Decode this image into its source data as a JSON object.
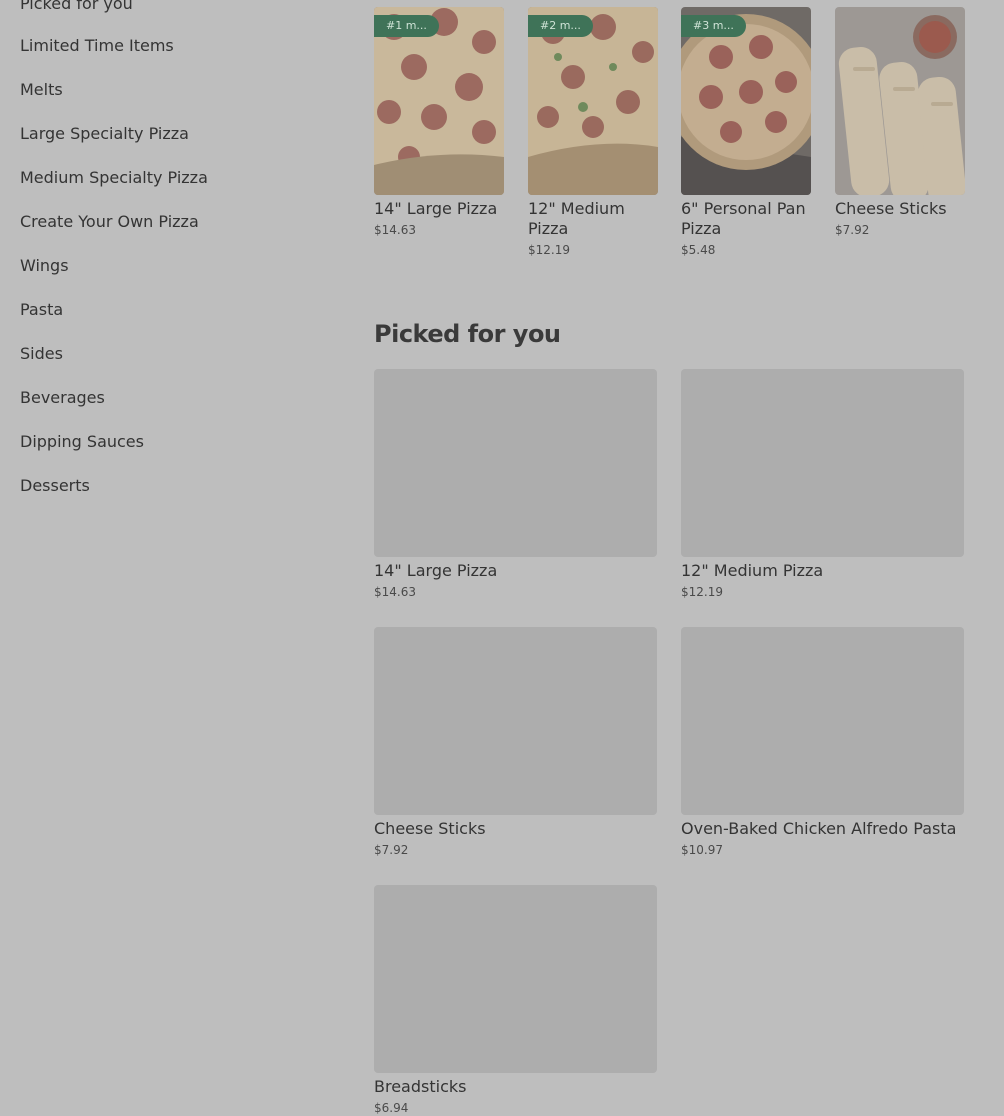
{
  "sidebar": {
    "items": [
      {
        "label": "Picked for you"
      },
      {
        "label": "Limited Time Items"
      },
      {
        "label": "Melts"
      },
      {
        "label": "Large Specialty Pizza"
      },
      {
        "label": "Medium Specialty Pizza"
      },
      {
        "label": "Create Your Own Pizza"
      },
      {
        "label": "Wings"
      },
      {
        "label": "Pasta"
      },
      {
        "label": "Sides"
      },
      {
        "label": "Beverages"
      },
      {
        "label": "Dipping Sauces"
      },
      {
        "label": "Desserts"
      }
    ]
  },
  "popular": [
    {
      "badge": "#1 m...",
      "name": "14\" Large Pizza",
      "price": "$14.63",
      "icon": "pizza-image"
    },
    {
      "badge": "#2 m...",
      "name": "12\" Medium Pizza",
      "price": "$12.19",
      "icon": "pizza-image"
    },
    {
      "badge": "#3 m...",
      "name": "6\" Personal Pan Pizza",
      "price": "$5.48",
      "icon": "pizza-image"
    },
    {
      "badge": "",
      "name": "Cheese Sticks",
      "price": "$7.92",
      "icon": "cheese-sticks-image"
    }
  ],
  "picked": {
    "title": "Picked for you",
    "items": [
      {
        "name": "14\" Large Pizza",
        "price": "$14.63"
      },
      {
        "name": "12\" Medium Pizza",
        "price": "$12.19"
      },
      {
        "name": "Cheese Sticks",
        "price": "$7.92"
      },
      {
        "name": "Oven-Baked Chicken Alfredo Pasta",
        "price": "$10.97"
      },
      {
        "name": "Breadsticks",
        "price": "$6.94"
      }
    ]
  }
}
